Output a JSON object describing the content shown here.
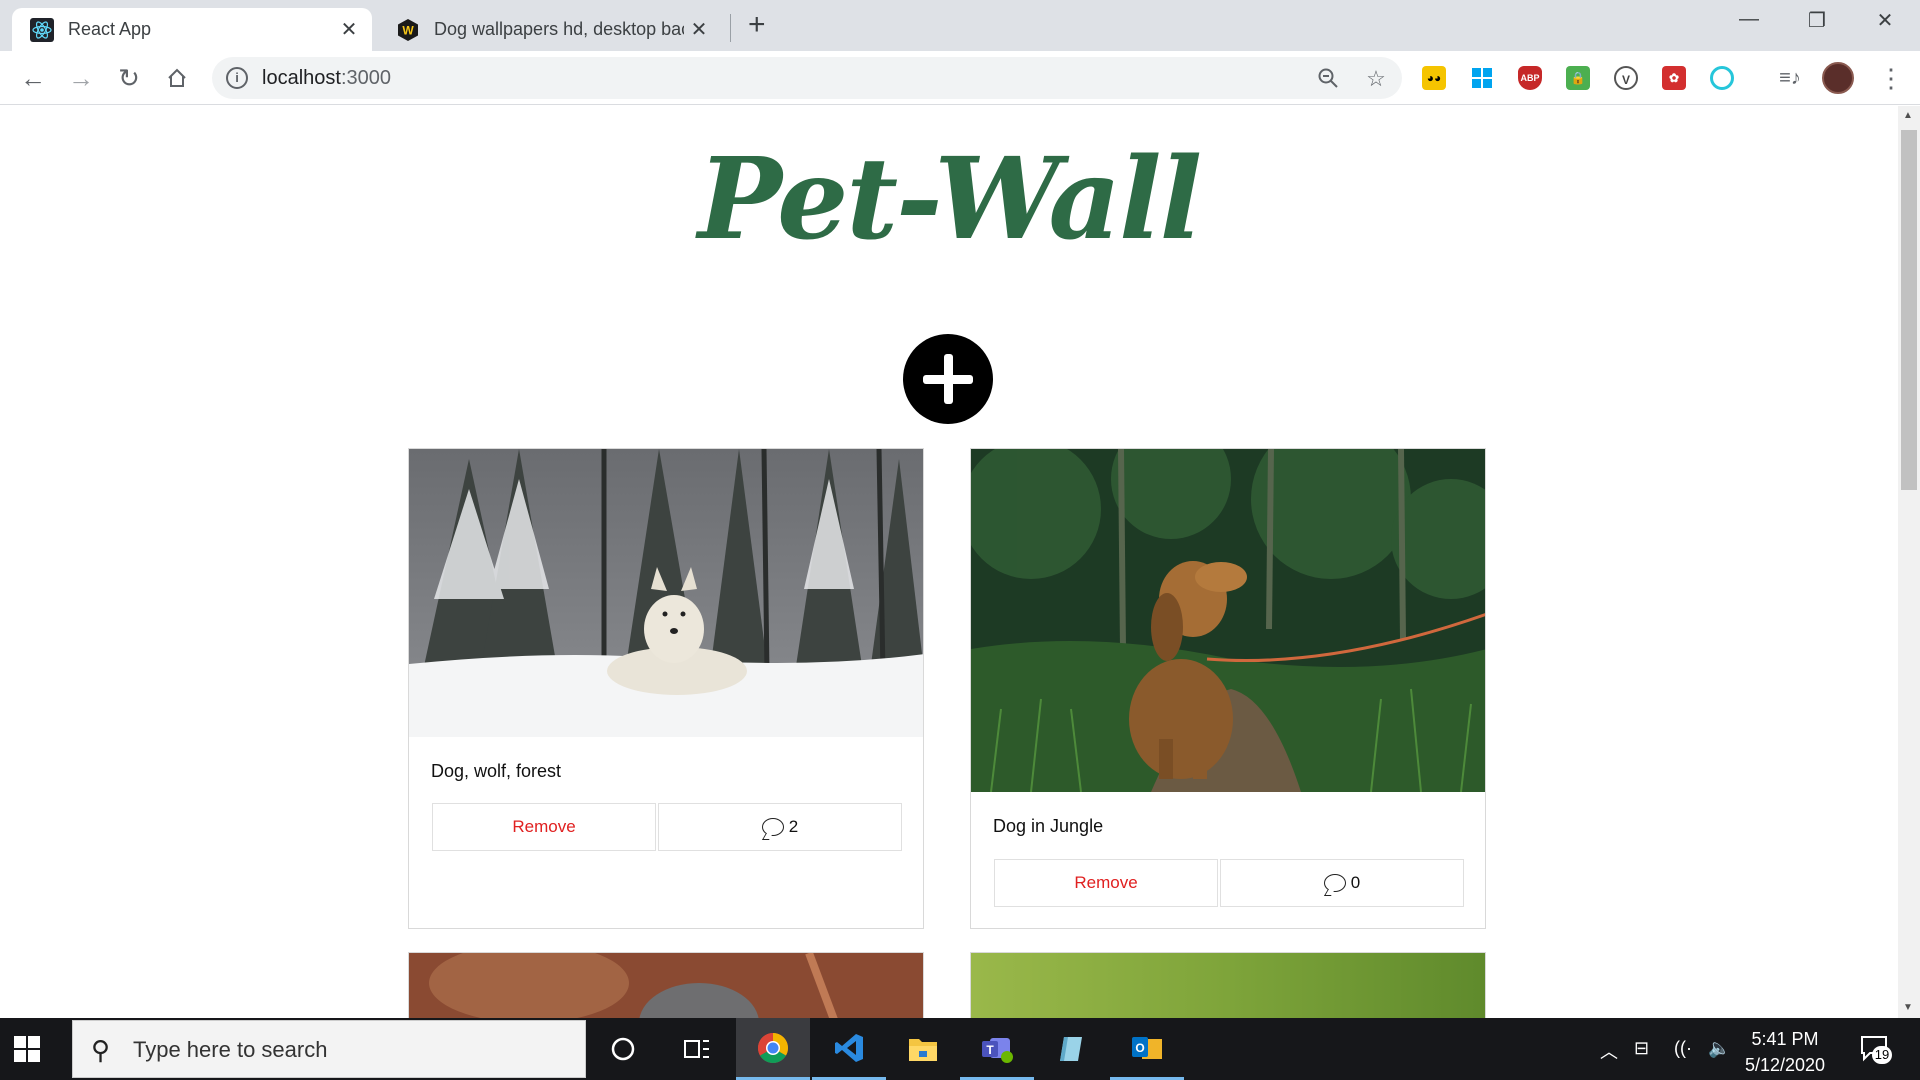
{
  "browser": {
    "tabs": [
      {
        "title": "React App",
        "active": true
      },
      {
        "title": "Dog wallpapers hd, desktop backgrounds",
        "active": false
      }
    ],
    "address": {
      "host": "localhost",
      "port": ":3000"
    }
  },
  "page": {
    "logo": "Pet-Wall",
    "cards": [
      {
        "caption": "Dog, wolf, forest",
        "remove_label": "Remove",
        "comment_count": "2"
      },
      {
        "caption": "Dog in Jungle",
        "remove_label": "Remove",
        "comment_count": "0"
      }
    ]
  },
  "taskbar": {
    "search_placeholder": "Type here to search",
    "time": "5:41 PM",
    "date": "5/12/2020",
    "notification_count": "19"
  },
  "colors": {
    "logo": "#2e6b46",
    "remove": "#e02020",
    "taskbar": "#16171a"
  }
}
